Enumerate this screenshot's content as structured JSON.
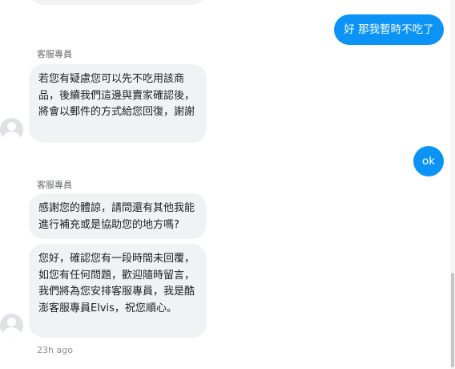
{
  "conversation": {
    "messages": [
      {
        "from": "customer",
        "text": "好 那我暫時不吃了"
      },
      {
        "from": "agent",
        "sender": "客服專員",
        "text": "若您有疑慮您可以先不吃用該商品，後續我們這邊與賣家確認後，將會以郵件的方式給您回復，謝謝"
      },
      {
        "from": "customer",
        "text": "ok"
      },
      {
        "from": "agent",
        "sender": "客服專員",
        "text": "感謝您的體諒，請問還有其他我能進行補充或是協助您的地方嗎?"
      },
      {
        "from": "agent",
        "text": "您好，確認您有一段時間未回覆，如您有任何問題，歡迎隨時留言，我們將為您安排客服專員，我是酷澎客服專員Elvis，祝您順心。"
      }
    ],
    "timestamp": "23h ago"
  },
  "colors": {
    "outgoing_bubble": "#0b93f6",
    "incoming_bubble": "#f1f2f4",
    "muted_text": "#65676b"
  },
  "icons": {
    "avatar": "user-avatar-icon"
  }
}
